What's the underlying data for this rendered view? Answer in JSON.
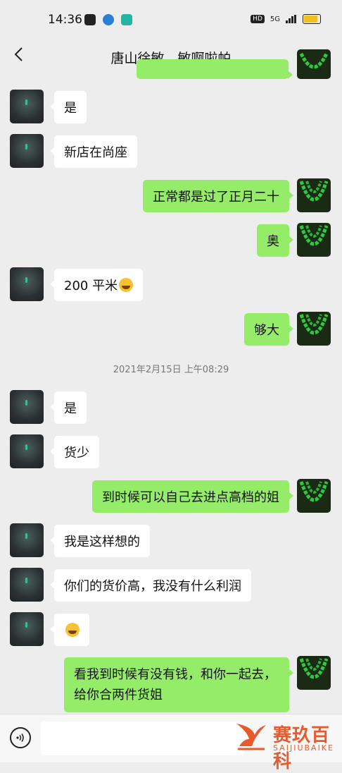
{
  "status_bar": {
    "time": "14:36",
    "network": "5G",
    "hd": "HD",
    "battery_level": 0.8
  },
  "header": {
    "title": "唐山徐敏，敏啊啦帕"
  },
  "messages": [
    {
      "side": "left",
      "text": "是"
    },
    {
      "side": "left",
      "text": "新店在尚座"
    },
    {
      "side": "right",
      "text": "正常都是过了正月二十"
    },
    {
      "side": "right",
      "text": "奥"
    },
    {
      "side": "left",
      "text": "200 平米",
      "emoji": "grimace-emoji"
    },
    {
      "side": "right",
      "text": "够大"
    },
    {
      "side": "left",
      "text": "是"
    },
    {
      "side": "left",
      "text": "货少"
    },
    {
      "side": "right",
      "text": "到时候可以自己去进点高档的姐"
    },
    {
      "side": "left",
      "text": "我是这样想的"
    },
    {
      "side": "left",
      "text": "你们的货价高，我没有什么利润"
    },
    {
      "side": "left",
      "text": "",
      "emoji": "grimace-emoji"
    },
    {
      "side": "right",
      "text": "看我到时候有没有钱，和你一起去，给你合两件货姐"
    }
  ],
  "timestamp": "2021年2月15日 上午08:29",
  "watermark": {
    "cn": "赛玖百科",
    "en": "SAIJIUBAIKE"
  },
  "colors": {
    "background": "#ededed",
    "sent_bubble": "#95ec69",
    "received_bubble": "#ffffff",
    "watermark": "#e85a2c"
  }
}
